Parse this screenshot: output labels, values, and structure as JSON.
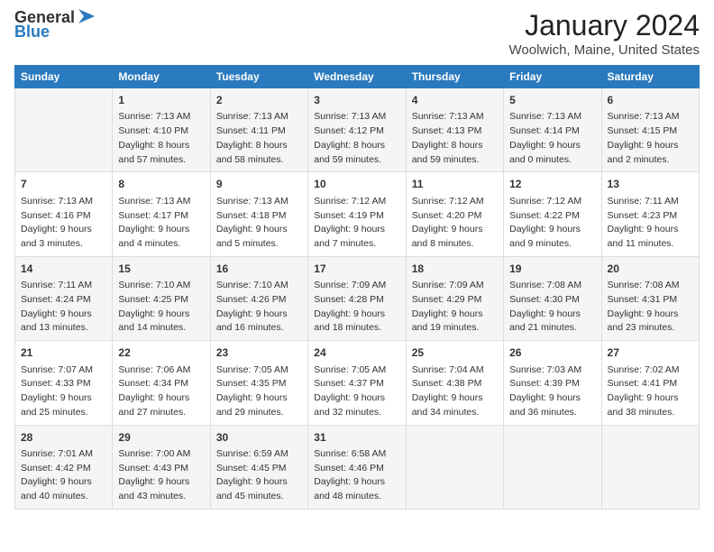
{
  "logo": {
    "line1": "General",
    "line2": "Blue"
  },
  "title": "January 2024",
  "subtitle": "Woolwich, Maine, United States",
  "header_days": [
    "Sunday",
    "Monday",
    "Tuesday",
    "Wednesday",
    "Thursday",
    "Friday",
    "Saturday"
  ],
  "weeks": [
    [
      {
        "day": "",
        "content": ""
      },
      {
        "day": "1",
        "content": "Sunrise: 7:13 AM\nSunset: 4:10 PM\nDaylight: 8 hours\nand 57 minutes."
      },
      {
        "day": "2",
        "content": "Sunrise: 7:13 AM\nSunset: 4:11 PM\nDaylight: 8 hours\nand 58 minutes."
      },
      {
        "day": "3",
        "content": "Sunrise: 7:13 AM\nSunset: 4:12 PM\nDaylight: 8 hours\nand 59 minutes."
      },
      {
        "day": "4",
        "content": "Sunrise: 7:13 AM\nSunset: 4:13 PM\nDaylight: 8 hours\nand 59 minutes."
      },
      {
        "day": "5",
        "content": "Sunrise: 7:13 AM\nSunset: 4:14 PM\nDaylight: 9 hours\nand 0 minutes."
      },
      {
        "day": "6",
        "content": "Sunrise: 7:13 AM\nSunset: 4:15 PM\nDaylight: 9 hours\nand 2 minutes."
      }
    ],
    [
      {
        "day": "7",
        "content": "Sunrise: 7:13 AM\nSunset: 4:16 PM\nDaylight: 9 hours\nand 3 minutes."
      },
      {
        "day": "8",
        "content": "Sunrise: 7:13 AM\nSunset: 4:17 PM\nDaylight: 9 hours\nand 4 minutes."
      },
      {
        "day": "9",
        "content": "Sunrise: 7:13 AM\nSunset: 4:18 PM\nDaylight: 9 hours\nand 5 minutes."
      },
      {
        "day": "10",
        "content": "Sunrise: 7:12 AM\nSunset: 4:19 PM\nDaylight: 9 hours\nand 7 minutes."
      },
      {
        "day": "11",
        "content": "Sunrise: 7:12 AM\nSunset: 4:20 PM\nDaylight: 9 hours\nand 8 minutes."
      },
      {
        "day": "12",
        "content": "Sunrise: 7:12 AM\nSunset: 4:22 PM\nDaylight: 9 hours\nand 9 minutes."
      },
      {
        "day": "13",
        "content": "Sunrise: 7:11 AM\nSunset: 4:23 PM\nDaylight: 9 hours\nand 11 minutes."
      }
    ],
    [
      {
        "day": "14",
        "content": "Sunrise: 7:11 AM\nSunset: 4:24 PM\nDaylight: 9 hours\nand 13 minutes."
      },
      {
        "day": "15",
        "content": "Sunrise: 7:10 AM\nSunset: 4:25 PM\nDaylight: 9 hours\nand 14 minutes."
      },
      {
        "day": "16",
        "content": "Sunrise: 7:10 AM\nSunset: 4:26 PM\nDaylight: 9 hours\nand 16 minutes."
      },
      {
        "day": "17",
        "content": "Sunrise: 7:09 AM\nSunset: 4:28 PM\nDaylight: 9 hours\nand 18 minutes."
      },
      {
        "day": "18",
        "content": "Sunrise: 7:09 AM\nSunset: 4:29 PM\nDaylight: 9 hours\nand 19 minutes."
      },
      {
        "day": "19",
        "content": "Sunrise: 7:08 AM\nSunset: 4:30 PM\nDaylight: 9 hours\nand 21 minutes."
      },
      {
        "day": "20",
        "content": "Sunrise: 7:08 AM\nSunset: 4:31 PM\nDaylight: 9 hours\nand 23 minutes."
      }
    ],
    [
      {
        "day": "21",
        "content": "Sunrise: 7:07 AM\nSunset: 4:33 PM\nDaylight: 9 hours\nand 25 minutes."
      },
      {
        "day": "22",
        "content": "Sunrise: 7:06 AM\nSunset: 4:34 PM\nDaylight: 9 hours\nand 27 minutes."
      },
      {
        "day": "23",
        "content": "Sunrise: 7:05 AM\nSunset: 4:35 PM\nDaylight: 9 hours\nand 29 minutes."
      },
      {
        "day": "24",
        "content": "Sunrise: 7:05 AM\nSunset: 4:37 PM\nDaylight: 9 hours\nand 32 minutes."
      },
      {
        "day": "25",
        "content": "Sunrise: 7:04 AM\nSunset: 4:38 PM\nDaylight: 9 hours\nand 34 minutes."
      },
      {
        "day": "26",
        "content": "Sunrise: 7:03 AM\nSunset: 4:39 PM\nDaylight: 9 hours\nand 36 minutes."
      },
      {
        "day": "27",
        "content": "Sunrise: 7:02 AM\nSunset: 4:41 PM\nDaylight: 9 hours\nand 38 minutes."
      }
    ],
    [
      {
        "day": "28",
        "content": "Sunrise: 7:01 AM\nSunset: 4:42 PM\nDaylight: 9 hours\nand 40 minutes."
      },
      {
        "day": "29",
        "content": "Sunrise: 7:00 AM\nSunset: 4:43 PM\nDaylight: 9 hours\nand 43 minutes."
      },
      {
        "day": "30",
        "content": "Sunrise: 6:59 AM\nSunset: 4:45 PM\nDaylight: 9 hours\nand 45 minutes."
      },
      {
        "day": "31",
        "content": "Sunrise: 6:58 AM\nSunset: 4:46 PM\nDaylight: 9 hours\nand 48 minutes."
      },
      {
        "day": "",
        "content": ""
      },
      {
        "day": "",
        "content": ""
      },
      {
        "day": "",
        "content": ""
      }
    ]
  ]
}
